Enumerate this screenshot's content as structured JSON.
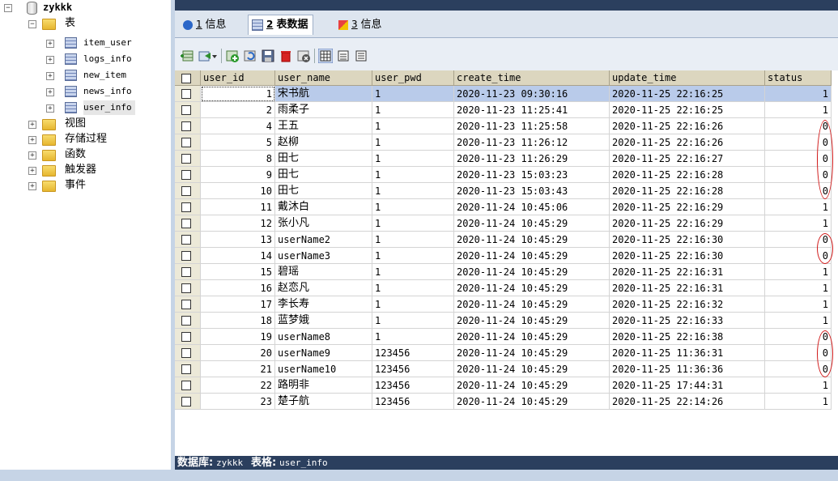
{
  "tree": {
    "database": "zykkk",
    "tables_folder": "表",
    "tables": [
      "item_user",
      "logs_info",
      "new_item",
      "news_info",
      "user_info"
    ],
    "folders": [
      "视图",
      "存储过程",
      "函数",
      "触发器",
      "事件"
    ]
  },
  "tabs": [
    {
      "num": "1",
      "label": "信息"
    },
    {
      "num": "2",
      "label": "表数据"
    },
    {
      "num": "3",
      "label": "信息"
    }
  ],
  "toolbar": {
    "icons": [
      "insert-row-icon",
      "export-icon",
      "dropdown-arrow-icon",
      "add-row-icon",
      "refresh-icon",
      "save-icon",
      "delete-icon",
      "clear-icon",
      "grid-view-icon",
      "form-view-icon",
      "text-view-icon"
    ]
  },
  "grid": {
    "columns": [
      "user_id",
      "user_name",
      "user_pwd",
      "create_time",
      "update_time",
      "status"
    ],
    "rows": [
      [
        "1",
        "宋书航",
        "1",
        "2020-11-23 09:30:16",
        "2020-11-25 22:16:25",
        "1"
      ],
      [
        "2",
        "雨柔子",
        "1",
        "2020-11-23 11:25:41",
        "2020-11-25 22:16:25",
        "1"
      ],
      [
        "4",
        "王五",
        "1",
        "2020-11-23 11:25:58",
        "2020-11-25 22:16:26",
        "0"
      ],
      [
        "5",
        "赵柳",
        "1",
        "2020-11-23 11:26:12",
        "2020-11-25 22:16:26",
        "0"
      ],
      [
        "8",
        "田七",
        "1",
        "2020-11-23 11:26:29",
        "2020-11-25 22:16:27",
        "0"
      ],
      [
        "9",
        "田七",
        "1",
        "2020-11-23 15:03:23",
        "2020-11-25 22:16:28",
        "0"
      ],
      [
        "10",
        "田七",
        "1",
        "2020-11-23 15:03:43",
        "2020-11-25 22:16:28",
        "0"
      ],
      [
        "11",
        "戴沐白",
        "1",
        "2020-11-24 10:45:06",
        "2020-11-25 22:16:29",
        "1"
      ],
      [
        "12",
        "张小凡",
        "1",
        "2020-11-24 10:45:29",
        "2020-11-25 22:16:29",
        "1"
      ],
      [
        "13",
        "userName2",
        "1",
        "2020-11-24 10:45:29",
        "2020-11-25 22:16:30",
        "0"
      ],
      [
        "14",
        "userName3",
        "1",
        "2020-11-24 10:45:29",
        "2020-11-25 22:16:30",
        "0"
      ],
      [
        "15",
        "碧瑶",
        "1",
        "2020-11-24 10:45:29",
        "2020-11-25 22:16:31",
        "1"
      ],
      [
        "16",
        "赵恋凡",
        "1",
        "2020-11-24 10:45:29",
        "2020-11-25 22:16:31",
        "1"
      ],
      [
        "17",
        "李长寿",
        "1",
        "2020-11-24 10:45:29",
        "2020-11-25 22:16:32",
        "1"
      ],
      [
        "18",
        "蓝梦娥",
        "1",
        "2020-11-24 10:45:29",
        "2020-11-25 22:16:33",
        "1"
      ],
      [
        "19",
        "userName8",
        "1",
        "2020-11-24 10:45:29",
        "2020-11-25 22:16:38",
        "0"
      ],
      [
        "20",
        "userName9",
        "123456",
        "2020-11-24 10:45:29",
        "2020-11-25 11:36:31",
        "0"
      ],
      [
        "21",
        "userName10",
        "123456",
        "2020-11-24 10:45:29",
        "2020-11-25 11:36:36",
        "0"
      ],
      [
        "22",
        "路明非",
        "123456",
        "2020-11-24 10:45:29",
        "2020-11-25 17:44:31",
        "1"
      ],
      [
        "23",
        "楚子航",
        "123456",
        "2020-11-24 10:45:29",
        "2020-11-25 22:14:26",
        "1"
      ]
    ],
    "selected_row_index": 0
  },
  "statusbar": {
    "db_label": "数据库:",
    "db_value": "zykkk",
    "table_label": "表格:",
    "table_value": "user_info"
  },
  "colors": {
    "header_bg": "#dcd6bf",
    "selection": "#b9cbea",
    "statusbar": "#2b3f5e",
    "annotation": "#d01818"
  }
}
